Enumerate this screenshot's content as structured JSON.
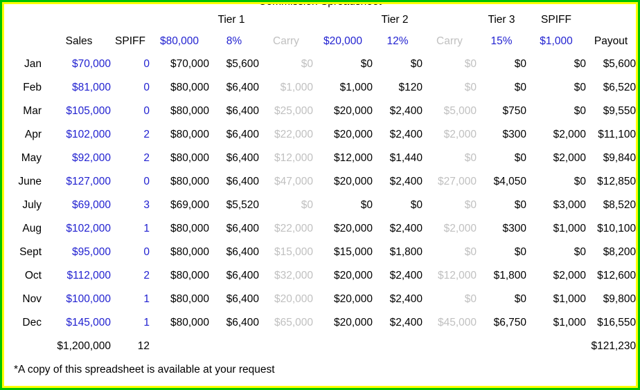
{
  "document": {
    "clipped_title": "Commission Spreadsheet",
    "footnote": "*A copy of this spreadsheet is available at your request"
  },
  "colors": {
    "border_outer": "#00c000",
    "border_inner": "#ffff00",
    "accent_blue": "#1f1fd0",
    "muted_gray": "#c0c0c0",
    "text": "#000000",
    "background": "#ffffff"
  },
  "group_headers": {
    "tier1": "Tier 1",
    "tier2": "Tier 2",
    "tier3": "Tier 3",
    "spiff": "SPIFF"
  },
  "column_headers": {
    "month": "",
    "sales": "Sales",
    "spiff_count": "SPIFF",
    "tier1_base": "$80,000",
    "tier1_rate": "8%",
    "tier1_carry": "Carry",
    "tier2_base": "$20,000",
    "tier2_rate": "12%",
    "tier2_carry": "Carry",
    "tier3_rate": "15%",
    "spiff_value": "$1,000",
    "payout": "Payout"
  },
  "rows": [
    {
      "month": "Jan",
      "sales": "$70,000",
      "spiff_count": "0",
      "tier1_base": "$70,000",
      "tier1_comm": "$5,600",
      "tier1_carry": "$0",
      "tier2_base": "$0",
      "tier2_comm": "$0",
      "tier2_carry": "$0",
      "tier3_comm": "$0",
      "spiff_payout": "$0",
      "payout": "$5,600"
    },
    {
      "month": "Feb",
      "sales": "$81,000",
      "spiff_count": "0",
      "tier1_base": "$80,000",
      "tier1_comm": "$6,400",
      "tier1_carry": "$1,000",
      "tier2_base": "$1,000",
      "tier2_comm": "$120",
      "tier2_carry": "$0",
      "tier3_comm": "$0",
      "spiff_payout": "$0",
      "payout": "$6,520"
    },
    {
      "month": "Mar",
      "sales": "$105,000",
      "spiff_count": "0",
      "tier1_base": "$80,000",
      "tier1_comm": "$6,400",
      "tier1_carry": "$25,000",
      "tier2_base": "$20,000",
      "tier2_comm": "$2,400",
      "tier2_carry": "$5,000",
      "tier3_comm": "$750",
      "spiff_payout": "$0",
      "payout": "$9,550"
    },
    {
      "month": "Apr",
      "sales": "$102,000",
      "spiff_count": "2",
      "tier1_base": "$80,000",
      "tier1_comm": "$6,400",
      "tier1_carry": "$22,000",
      "tier2_base": "$20,000",
      "tier2_comm": "$2,400",
      "tier2_carry": "$2,000",
      "tier3_comm": "$300",
      "spiff_payout": "$2,000",
      "payout": "$11,100"
    },
    {
      "month": "May",
      "sales": "$92,000",
      "spiff_count": "2",
      "tier1_base": "$80,000",
      "tier1_comm": "$6,400",
      "tier1_carry": "$12,000",
      "tier2_base": "$12,000",
      "tier2_comm": "$1,440",
      "tier2_carry": "$0",
      "tier3_comm": "$0",
      "spiff_payout": "$2,000",
      "payout": "$9,840"
    },
    {
      "month": "June",
      "sales": "$127,000",
      "spiff_count": "0",
      "tier1_base": "$80,000",
      "tier1_comm": "$6,400",
      "tier1_carry": "$47,000",
      "tier2_base": "$20,000",
      "tier2_comm": "$2,400",
      "tier2_carry": "$27,000",
      "tier3_comm": "$4,050",
      "spiff_payout": "$0",
      "payout": "$12,850"
    },
    {
      "month": "July",
      "sales": "$69,000",
      "spiff_count": "3",
      "tier1_base": "$69,000",
      "tier1_comm": "$5,520",
      "tier1_carry": "$0",
      "tier2_base": "$0",
      "tier2_comm": "$0",
      "tier2_carry": "$0",
      "tier3_comm": "$0",
      "spiff_payout": "$3,000",
      "payout": "$8,520"
    },
    {
      "month": "Aug",
      "sales": "$102,000",
      "spiff_count": "1",
      "tier1_base": "$80,000",
      "tier1_comm": "$6,400",
      "tier1_carry": "$22,000",
      "tier2_base": "$20,000",
      "tier2_comm": "$2,400",
      "tier2_carry": "$2,000",
      "tier3_comm": "$300",
      "spiff_payout": "$1,000",
      "payout": "$10,100"
    },
    {
      "month": "Sept",
      "sales": "$95,000",
      "spiff_count": "0",
      "tier1_base": "$80,000",
      "tier1_comm": "$6,400",
      "tier1_carry": "$15,000",
      "tier2_base": "$15,000",
      "tier2_comm": "$1,800",
      "tier2_carry": "$0",
      "tier3_comm": "$0",
      "spiff_payout": "$0",
      "payout": "$8,200"
    },
    {
      "month": "Oct",
      "sales": "$112,000",
      "spiff_count": "2",
      "tier1_base": "$80,000",
      "tier1_comm": "$6,400",
      "tier1_carry": "$32,000",
      "tier2_base": "$20,000",
      "tier2_comm": "$2,400",
      "tier2_carry": "$12,000",
      "tier3_comm": "$1,800",
      "spiff_payout": "$2,000",
      "payout": "$12,600"
    },
    {
      "month": "Nov",
      "sales": "$100,000",
      "spiff_count": "1",
      "tier1_base": "$80,000",
      "tier1_comm": "$6,400",
      "tier1_carry": "$20,000",
      "tier2_base": "$20,000",
      "tier2_comm": "$2,400",
      "tier2_carry": "$0",
      "tier3_comm": "$0",
      "spiff_payout": "$1,000",
      "payout": "$9,800"
    },
    {
      "month": "Dec",
      "sales": "$145,000",
      "spiff_count": "1",
      "tier1_base": "$80,000",
      "tier1_comm": "$6,400",
      "tier1_carry": "$65,000",
      "tier2_base": "$20,000",
      "tier2_comm": "$2,400",
      "tier2_carry": "$45,000",
      "tier3_comm": "$6,750",
      "spiff_payout": "$1,000",
      "payout": "$16,550"
    }
  ],
  "totals": {
    "sales": "$1,200,000",
    "spiff_count": "12",
    "payout": "$121,230"
  }
}
